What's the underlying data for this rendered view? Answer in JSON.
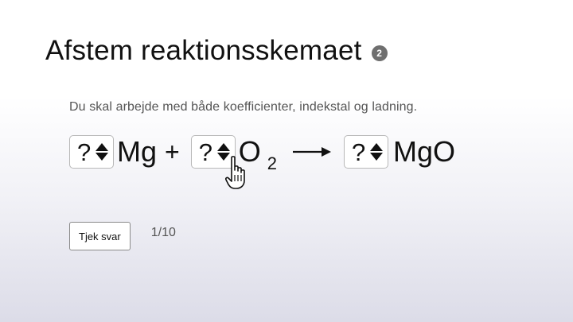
{
  "header": {
    "title": "Afstem reaktionsskemaet",
    "badge": "2"
  },
  "instructions": "Du skal arbejde med både koefficienter, indekstal og ladning.",
  "equation": {
    "coefficient_1": "?",
    "reactant_1": "Mg",
    "plus": "+",
    "coefficient_2": "?",
    "reactant_2_element": "O",
    "reactant_2_subscript": "2",
    "coefficient_3": "?",
    "product": "MgO"
  },
  "controls": {
    "check_label": "Tjek svar",
    "progress": "1/10"
  },
  "icons": {
    "help": "number-badge-icon",
    "stepper": "up-down-arrows-icon",
    "reaction": "right-arrow-icon",
    "cursor": "hand-pointer-icon"
  }
}
